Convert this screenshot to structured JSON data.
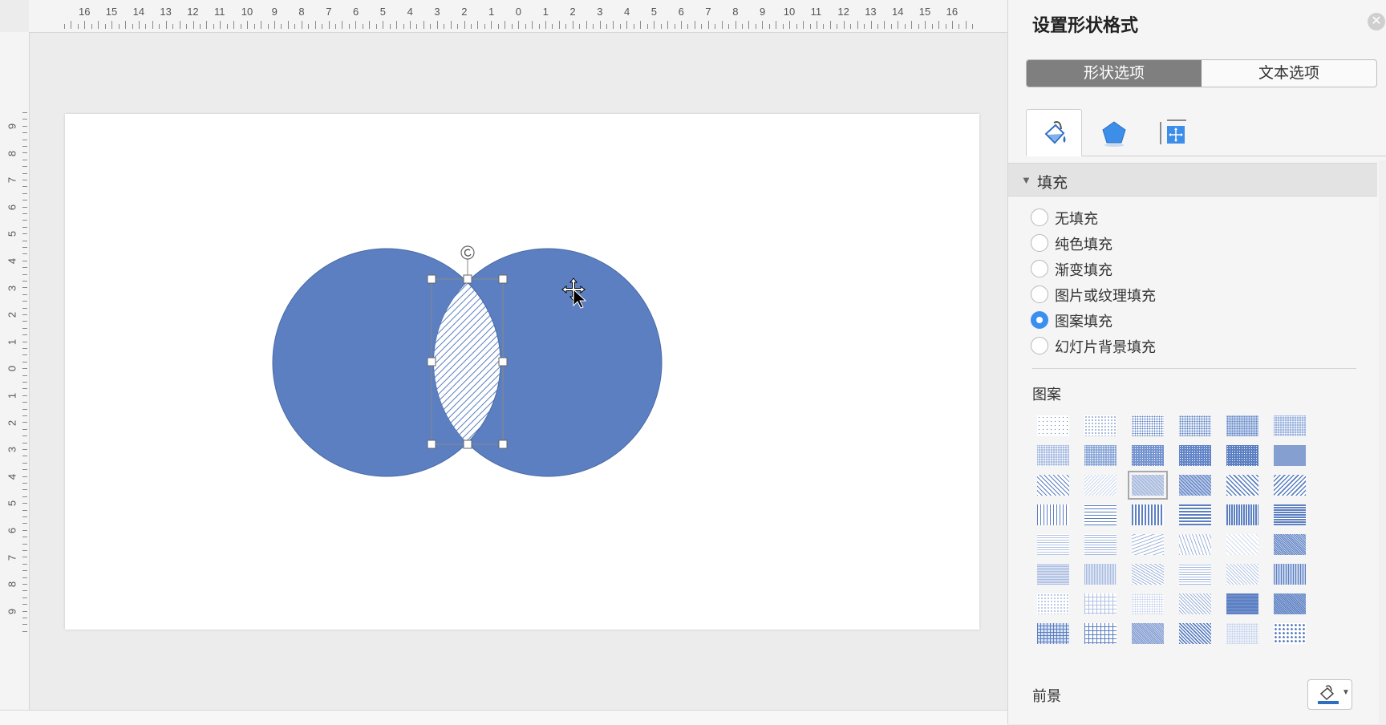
{
  "ruler": {
    "h_labels": [
      "16",
      "15",
      "14",
      "13",
      "12",
      "11",
      "10",
      "9",
      "8",
      "7",
      "6",
      "5",
      "4",
      "3",
      "2",
      "1",
      "0",
      "1",
      "2",
      "3",
      "4",
      "5",
      "6",
      "7",
      "8",
      "9",
      "10",
      "11",
      "12",
      "13",
      "14",
      "15",
      "16"
    ],
    "v_labels": [
      "9",
      "8",
      "7",
      "6",
      "5",
      "4",
      "3",
      "2",
      "1",
      "0",
      "1",
      "2",
      "3",
      "4",
      "5",
      "6",
      "7",
      "8",
      "9"
    ]
  },
  "shape": {
    "fill_color": "#5b7fc1",
    "stroke_color": "#4a6aa6",
    "selection_handle_color": "#ffffff"
  },
  "panel": {
    "title": "设置形状格式",
    "close_icon": "close-icon",
    "tabs": [
      {
        "label": "形状选项",
        "active": true
      },
      {
        "label": "文本选项",
        "active": false
      }
    ],
    "icon_tabs": [
      {
        "icon": "paint-bucket-icon",
        "active": true
      },
      {
        "icon": "pentagon-effects-icon",
        "active": false
      },
      {
        "icon": "size-layout-icon",
        "active": false
      }
    ],
    "fill_section": {
      "label": "填充",
      "options": [
        {
          "label": "无填充",
          "selected": false
        },
        {
          "label": "纯色填充",
          "selected": false
        },
        {
          "label": "渐变填充",
          "selected": false
        },
        {
          "label": "图片或纹理填充",
          "selected": false
        },
        {
          "label": "图案填充",
          "selected": true
        },
        {
          "label": "幻灯片背景填充",
          "selected": false
        }
      ],
      "pattern_label": "图案",
      "selected_pattern_index": 14,
      "foreground_label": "前景"
    },
    "accent_color": "#3b8ff0",
    "pattern_color": "#5b7fc1"
  }
}
